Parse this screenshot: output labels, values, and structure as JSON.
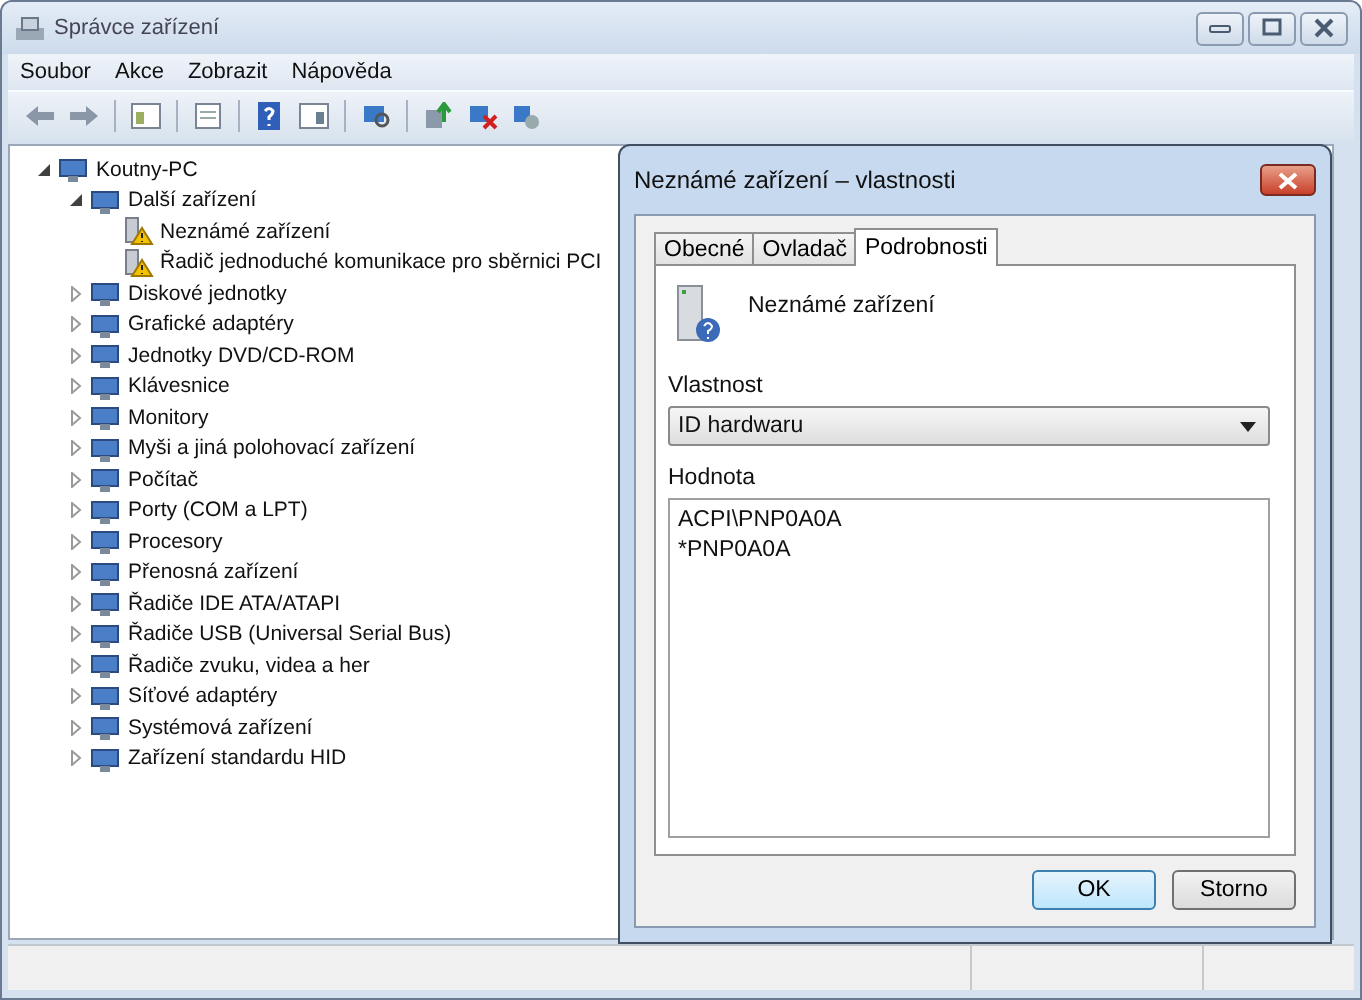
{
  "window": {
    "title": "Správce zařízení"
  },
  "menu": [
    "Soubor",
    "Akce",
    "Zobrazit",
    "Nápověda"
  ],
  "tree": [
    {
      "label": "Koutny-PC",
      "expanded": true,
      "warning": false,
      "children": [
        {
          "label": "Další zařízení",
          "expanded": true,
          "warning": false,
          "children": [
            {
              "label": "Neznámé zařízení",
              "warning": true
            },
            {
              "label": "Řadič jednoduché komunikace pro sběrnici PCI",
              "warning": true
            }
          ]
        },
        {
          "label": "Diskové jednotky",
          "expanded": false,
          "warning": false
        },
        {
          "label": "Grafické adaptéry",
          "expanded": false,
          "warning": false
        },
        {
          "label": "Jednotky DVD/CD-ROM",
          "expanded": false,
          "warning": false
        },
        {
          "label": "Klávesnice",
          "expanded": false,
          "warning": false
        },
        {
          "label": "Monitory",
          "expanded": false,
          "warning": false
        },
        {
          "label": "Myši a jiná polohovací zařízení",
          "expanded": false,
          "warning": false
        },
        {
          "label": "Počítač",
          "expanded": false,
          "warning": false
        },
        {
          "label": "Porty (COM a LPT)",
          "expanded": false,
          "warning": false
        },
        {
          "label": "Procesory",
          "expanded": false,
          "warning": false
        },
        {
          "label": "Přenosná zařízení",
          "expanded": false,
          "warning": false
        },
        {
          "label": "Řadiče IDE ATA/ATAPI",
          "expanded": false,
          "warning": false
        },
        {
          "label": "Řadiče USB (Universal Serial Bus)",
          "expanded": false,
          "warning": false
        },
        {
          "label": "Řadiče zvuku, videa a her",
          "expanded": false,
          "warning": false
        },
        {
          "label": "Síťové adaptéry",
          "expanded": false,
          "warning": false
        },
        {
          "label": "Systémová zařízení",
          "expanded": false,
          "warning": false
        },
        {
          "label": "Zařízení standardu HID",
          "expanded": false,
          "warning": false
        }
      ]
    }
  ],
  "dialog": {
    "title": "Neznámé zařízení – vlastnosti",
    "tabs": [
      {
        "label": "Obecné",
        "selected": false
      },
      {
        "label": "Ovladač",
        "selected": false
      },
      {
        "label": "Podrobnosti",
        "selected": true
      }
    ],
    "device_name": "Neznámé zařízení",
    "property_label": "Vlastnost",
    "property_value": "ID hardwaru",
    "value_label": "Hodnota",
    "values": [
      "ACPI\\PNP0A0A",
      "*PNP0A0A"
    ],
    "buttons": [
      {
        "label": "OK",
        "default": true
      },
      {
        "label": "Storno",
        "default": false
      }
    ]
  }
}
